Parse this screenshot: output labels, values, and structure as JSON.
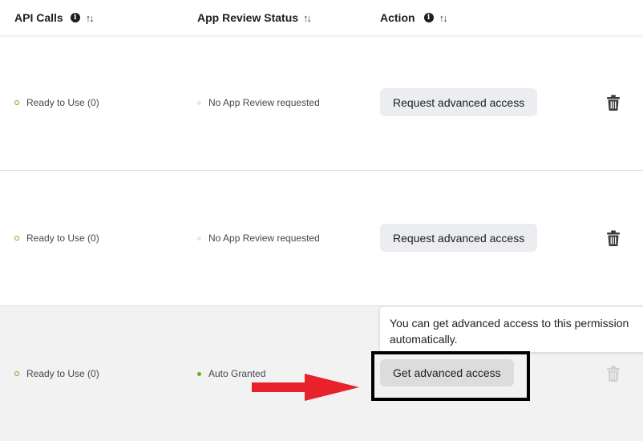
{
  "header": {
    "col_api_calls": "API Calls",
    "col_app_review": "App Review Status",
    "col_action": "Action",
    "info_glyph": "i",
    "sort_glyph": "↑↓"
  },
  "rows": [
    {
      "api_status": "Ready to Use (0)",
      "review_status": "No App Review requested",
      "action_label": "Request advanced access"
    },
    {
      "api_status": "Ready to Use (0)",
      "review_status": "No App Review requested",
      "action_label": "Request advanced access"
    },
    {
      "api_status": "Ready to Use (0)",
      "review_status": "Auto Granted",
      "action_label": "Get advanced access"
    }
  ],
  "tooltip": {
    "text": "You can get advanced access to this permission automatically."
  },
  "colors": {
    "ready_green": "#63b31a",
    "arrow_red": "#e8222a",
    "trash_active": "#3a3a3a",
    "trash_disabled": "#d0d0d0"
  },
  "icons": {
    "info": "info-icon",
    "sort": "sort-arrows-icon",
    "delete": "trash-icon",
    "pointer": "red-arrow-icon"
  }
}
